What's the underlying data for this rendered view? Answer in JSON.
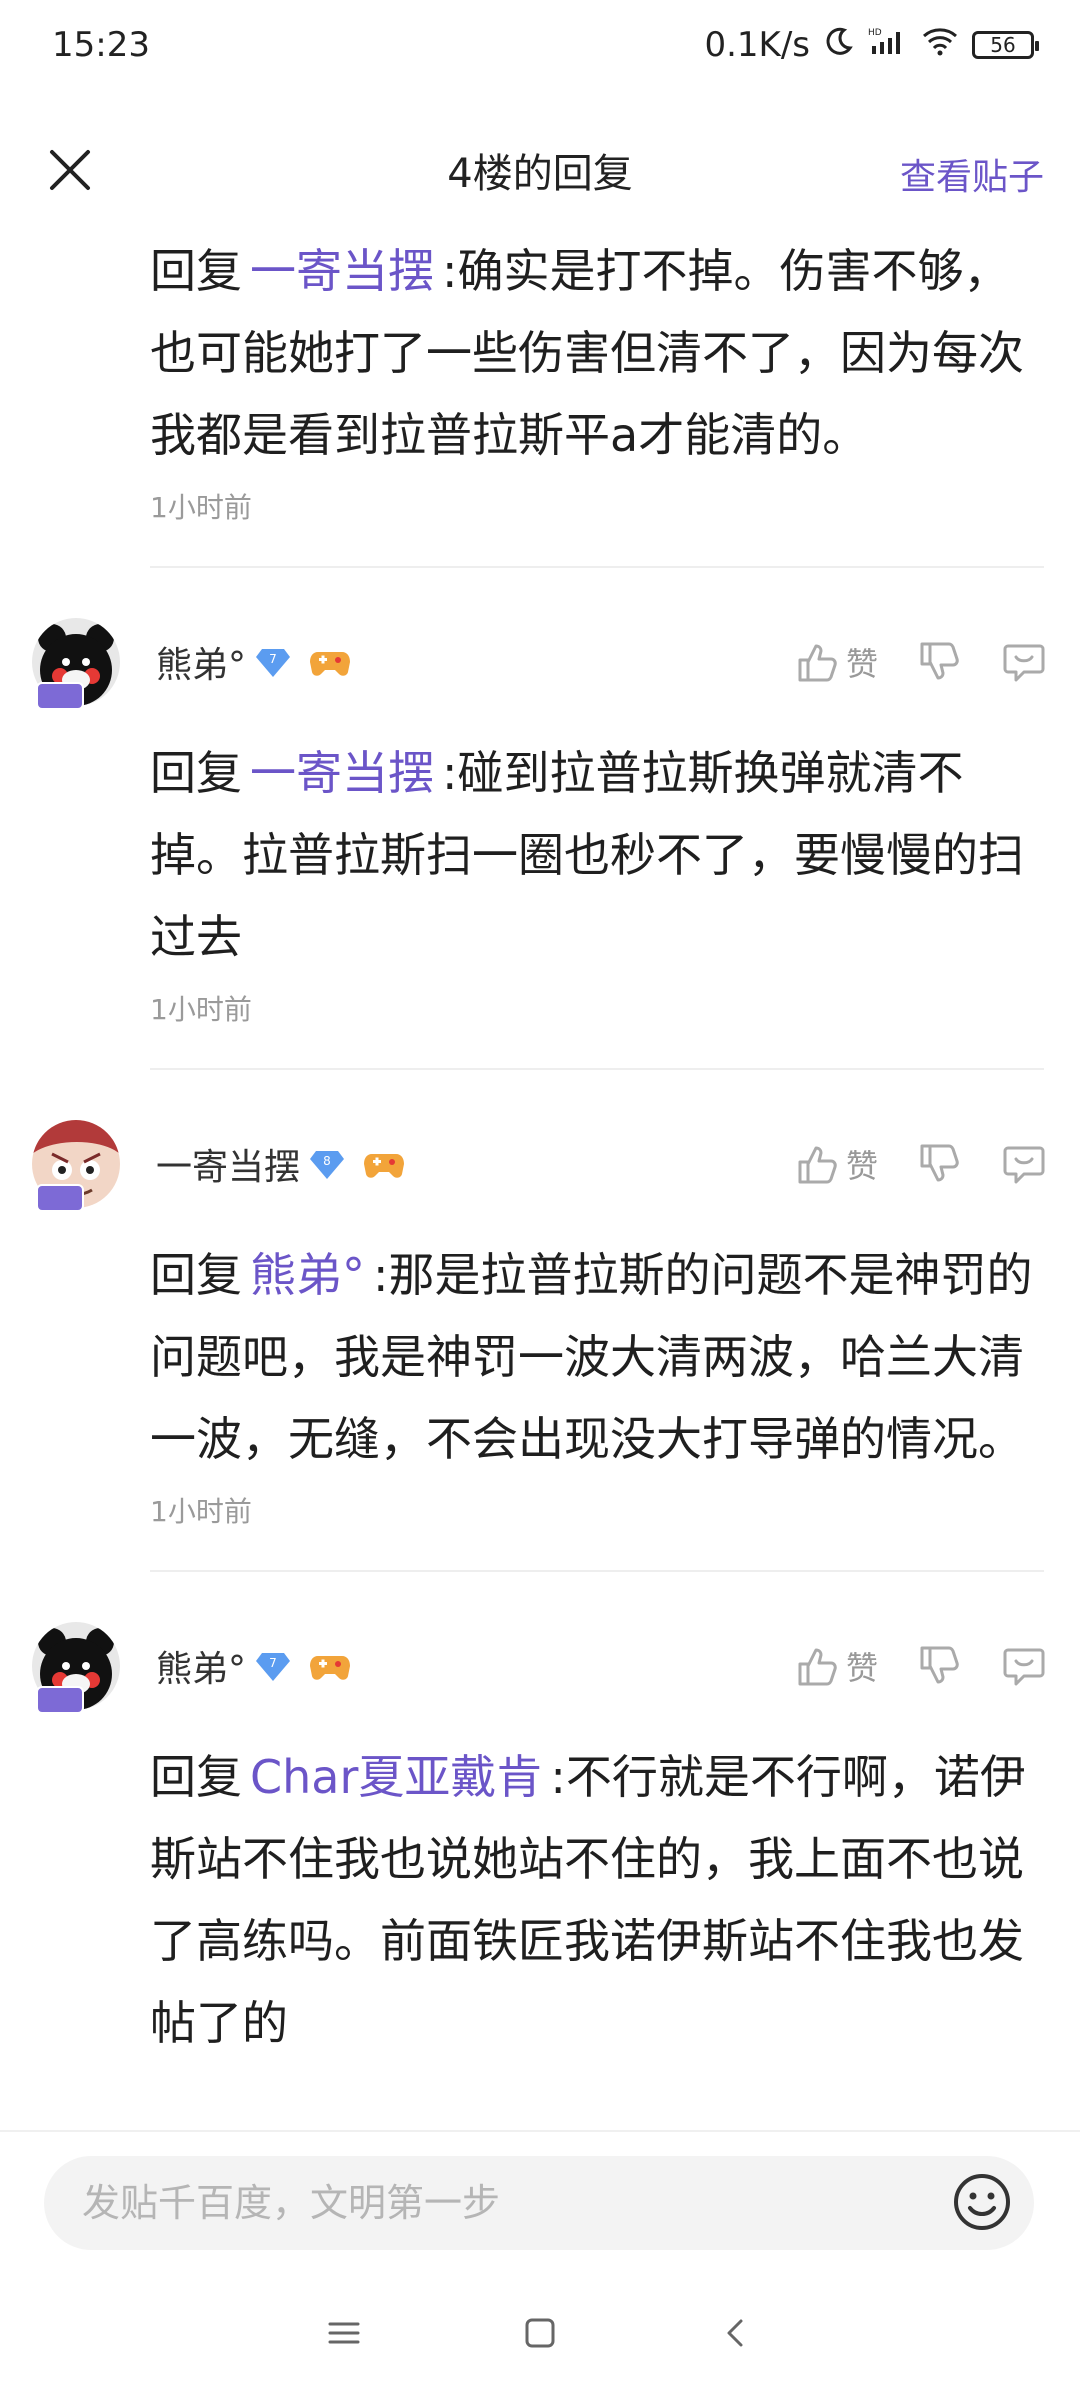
{
  "status_bar": {
    "time": "15:23",
    "net_speed": "0.1K/s",
    "battery": "56"
  },
  "header": {
    "title": "4楼的回复",
    "view_post": "查看贴子"
  },
  "top_reply": {
    "prefix": "回复",
    "mention": "一寄当摆",
    "text": ":确实是打不掉。伤害不够，也可能她打了一些伤害但清不了，因为每次我都是看到拉普拉斯平a才能清的。",
    "time": "1小时前"
  },
  "comments": [
    {
      "username": "熊弟°",
      "level": "7",
      "like_label": "赞",
      "reply_prefix": "回复",
      "mention": "一寄当摆",
      "text": ":碰到拉普拉斯换弹就清不掉。拉普拉斯扫一圈也秒不了，要慢慢的扫过去",
      "time": "1小时前"
    },
    {
      "username": "一寄当摆",
      "level": "8",
      "like_label": "赞",
      "reply_prefix": "回复",
      "mention": "熊弟°",
      "text": ":那是拉普拉斯的问题不是神罚的问题吧，我是神罚一波大清两波，哈兰大清一波，无缝，不会出现没大打导弹的情况。",
      "time": "1小时前"
    },
    {
      "username": "熊弟°",
      "level": "7",
      "like_label": "赞",
      "reply_prefix": "回复",
      "mention": "Char夏亚戴肯",
      "text": ":不行就是不行啊，诺伊斯站不住我也说她站不住的，我上面不也说了高练吗。前面铁匠我诺伊斯站不住我也发帖了的",
      "time": ""
    }
  ],
  "input": {
    "placeholder": "发贴千百度，文明第一步"
  },
  "colors": {
    "accent": "#6b55c8",
    "level_badge": "#5b9cf0",
    "secondary_text": "#9a9a9a"
  }
}
